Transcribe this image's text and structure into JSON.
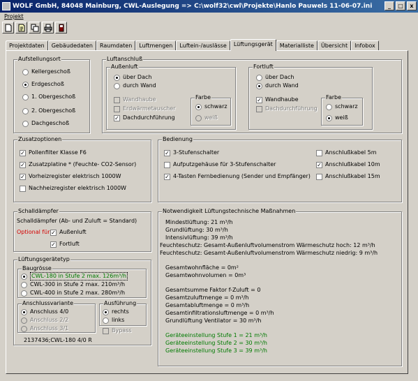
{
  "window": {
    "title": "WOLF GmbH, 84048 Mainburg, CWL-Auslegung   => C:\\wolf32\\cwl\\Projekte\\Hanlo Pauwels 11-06-07.ini",
    "buttons": [
      "_",
      "□",
      "x"
    ]
  },
  "menu": {
    "projekt": "Projekt"
  },
  "toolbar": {
    "icons": [
      "new-document-icon",
      "edit-document-icon",
      "copy-document-icon",
      "print-icon",
      "exit-icon"
    ]
  },
  "tabs": [
    "Projektdaten",
    "Gebäudedaten",
    "Raumdaten",
    "Luftmengen",
    "Luftein-/auslässe",
    "Lüftungsgerät",
    "Materialliste",
    "Übersicht",
    "Infobox"
  ],
  "active_tab": "Lüftungsgerät",
  "aufstellungsort": {
    "title": "Aufstellungsort",
    "options": [
      "Kellergeschoß",
      "Erdgeschoß",
      "1. Obergeschoß",
      "2. Obergeschoß",
      "Dachgeschoß"
    ],
    "selected": "Erdgeschoß"
  },
  "luftanschluss": {
    "title": "Luftanschluß",
    "aussenluft": {
      "title": "Außenluft",
      "options": [
        "über Dach",
        "durch Wand"
      ],
      "selected": "über Dach",
      "checks": [
        {
          "label": "Wandhaube",
          "checked": false,
          "disabled": true
        },
        {
          "label": "Erdwärmetauscher",
          "checked": false,
          "disabled": true
        },
        {
          "label": "Dachdurchführung",
          "checked": true,
          "disabled": false
        }
      ],
      "farbe": {
        "title": "Farbe",
        "options": [
          "schwarz",
          "weiß"
        ],
        "selected": "schwarz",
        "disabled_option": "weiß"
      }
    },
    "fortluft": {
      "title": "Fortluft",
      "options": [
        "über Dach",
        "durch Wand"
      ],
      "selected": "durch Wand",
      "checks": [
        {
          "label": "Wandhaube",
          "checked": true,
          "disabled": false
        },
        {
          "label": "Dachdurchführung",
          "checked": false,
          "disabled": true
        }
      ],
      "farbe": {
        "title": "Farbe",
        "options": [
          "schwarz",
          "weiß"
        ],
        "selected": "weiß"
      }
    }
  },
  "zusatzoptionen": {
    "title": "Zusatzoptionen",
    "items": [
      {
        "label": "Pollenfilter Klasse F6",
        "checked": true
      },
      {
        "label": "Zusatzplatine * (Feuchte- CO2-Sensor)",
        "checked": true
      },
      {
        "label": "Vorheizregister elektrisch 1000W",
        "checked": true
      },
      {
        "label": "Nachheizregister elektrisch 1000W",
        "checked": false
      }
    ]
  },
  "bedienung": {
    "title": "Bedienung",
    "left": [
      {
        "label": "3-Stufenschalter",
        "checked": true
      },
      {
        "label": "Aufputzgehäuse für 3-Stufenschalter",
        "checked": false
      },
      {
        "label": "4-Tasten Fernbedienung (Sender  und Empfänger)",
        "checked": true
      }
    ],
    "right": [
      {
        "label": "Anschlußkabel 5m",
        "checked": false
      },
      {
        "label": "Anschlußkabel 10m",
        "checked": true
      },
      {
        "label": "Anschlußkabel 15m",
        "checked": false
      }
    ]
  },
  "schalldaempfer": {
    "title": "Schalldämpfer",
    "desc": "Schalldämpfer  (Ab- und Zuluft = Standard)",
    "optional": "Optional für",
    "items": [
      {
        "label": "Außenluft",
        "checked": true
      },
      {
        "label": "Fortluft",
        "checked": true
      }
    ]
  },
  "lueftungsgeraetetyp": {
    "title": "Lüftungsgerätetyp",
    "baugroesse": {
      "title": "Baugrösse",
      "options": [
        "CWL-180  in Stufe 2 max. 126m³/h",
        "CWL-300  in Stufe 2 max. 210m³/h",
        "CWL-400  in Stufe 2 max. 280m³/h"
      ],
      "selected": 0
    },
    "anschlussvariante": {
      "title": "Anschlussvariante",
      "options": [
        "Anschluss 4/0",
        "Anschluss 2/2",
        "Anschluss 3/1"
      ],
      "selected": 0
    },
    "ausfuehrung": {
      "title": "Ausführung",
      "options": [
        "rechts",
        "links"
      ],
      "selected": 0,
      "bypass": "Bypass"
    },
    "code": "2137436;CWL-180 4/0 R"
  },
  "notwendigkeit": {
    "title": "Notwendigkeit Lüftungstechnische Maßnahmen",
    "lines1": [
      "Mindestlüftung: 21 m³/h",
      "Grundlüftung: 30 m³/h",
      "Intensivlüftung: 39 m³/h",
      "Feuchteschutz: Gesamt-Außenluftvolumenstrom Wärmeschutz hoch: 12 m³/h",
      "Feuchteschutz: Gesamt-Außenluftvolumenstrom Wärmeschutz niedrig: 9 m³/h"
    ],
    "lines2": [
      "Gesamtwohnfläche = 0m²",
      "Gesamtwohnvolumen = 0m³"
    ],
    "lines3": [
      "Gesamtsumme Faktor f-Zuluft = 0",
      "Gesamtzuluftmenge = 0 m³/h",
      "Gesamtabluftmenge = 0 m³/h",
      "Gesamtinfiltrationsluftmenge = 0 m³/h",
      "Grundlüftung Ventilator = 30 m³/h"
    ],
    "lines4": [
      "Geräteeinstellung Stufe 1 = 21 m³/h",
      "Geräteeinstellung Stufe 2 = 30 m³/h",
      "Geräteeinstellung Stufe 3 = 39 m³/h"
    ],
    "accent": "#007a00"
  }
}
